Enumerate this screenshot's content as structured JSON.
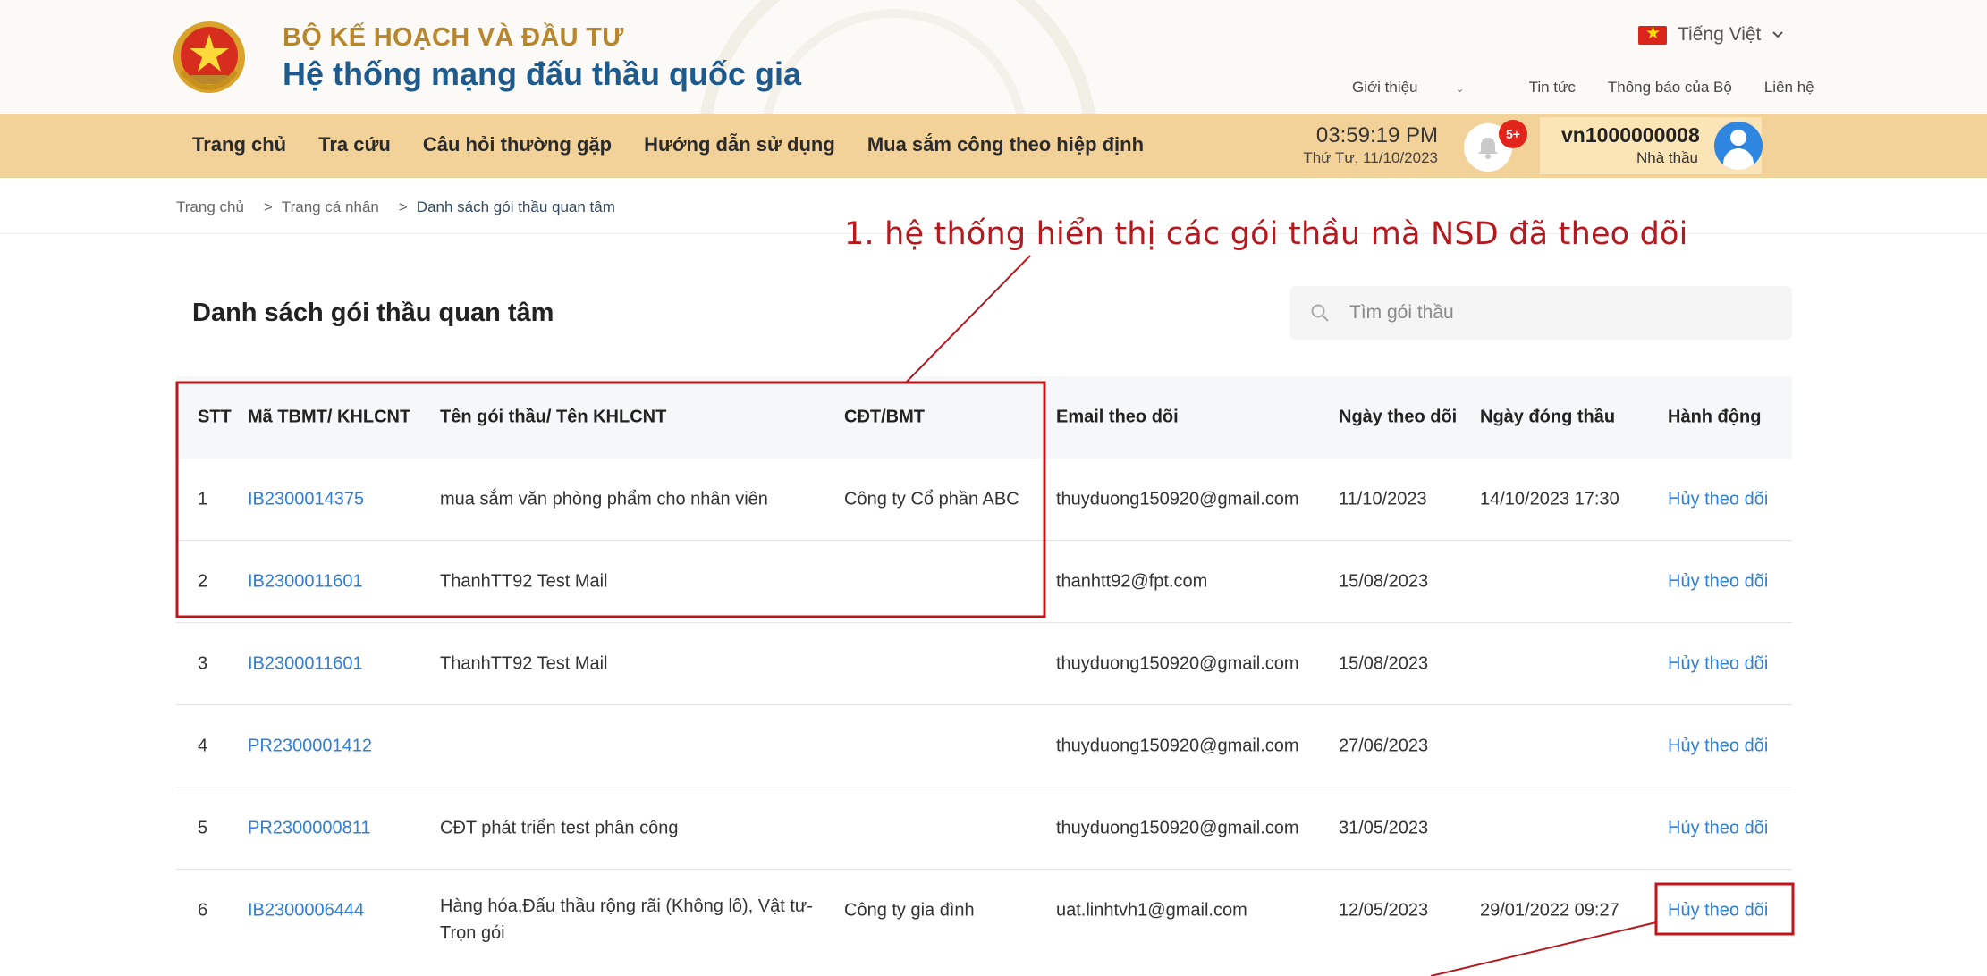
{
  "header": {
    "org_name": "BỘ KẾ HOẠCH VÀ ĐẦU TƯ",
    "system_name": "Hệ thống mạng đấu thầu quốc gia",
    "language": "Tiếng Việt",
    "top_links": [
      "Giới thiệu",
      "Tin tức",
      "Thông báo của Bộ",
      "Liên hệ"
    ]
  },
  "nav": {
    "items": [
      "Trang chủ",
      "Tra cứu",
      "Câu hỏi thường gặp",
      "Hướng dẫn sử dụng",
      "Mua sắm công theo hiệp định"
    ],
    "time": "03:59:19 PM",
    "date": "Thứ Tư, 11/10/2023",
    "notification_badge": "5+",
    "user_name": "vn1000000008",
    "user_role": "Nhà thầu"
  },
  "breadcrumb": [
    "Trang chủ",
    "Trang cá nhân",
    "Danh sách gói thầu quan tâm"
  ],
  "annotation": "1. hệ thống hiển thị các gói thầu mà NSD đã theo dõi",
  "page_title": "Danh sách gói thầu quan tâm",
  "search": {
    "placeholder": "Tìm gói thầu"
  },
  "table": {
    "headers": [
      "STT",
      "Mã TBMT/ KHLCNT",
      "Tên gói thầu/ Tên KHLCNT",
      "CĐT/BMT",
      "Email theo dõi",
      "Ngày theo dõi",
      "Ngày đóng thầu",
      "Hành động"
    ],
    "rows": [
      {
        "stt": "1",
        "code": "IB2300014375",
        "name": "mua sắm văn phòng phẩm cho nhân viên",
        "owner": "Công ty Cổ phần ABC",
        "email": "thuyduong150920@gmail.com",
        "follow_date": "11/10/2023",
        "close_date": "14/10/2023 17:30",
        "action": "Hủy theo dõi"
      },
      {
        "stt": "2",
        "code": "IB2300011601",
        "name": "ThanhTT92 Test Mail",
        "owner": "",
        "email": "thanhtt92@fpt.com",
        "follow_date": "15/08/2023",
        "close_date": "",
        "action": "Hủy theo dõi"
      },
      {
        "stt": "3",
        "code": "IB2300011601",
        "name": "ThanhTT92 Test Mail",
        "owner": "",
        "email": "thuyduong150920@gmail.com",
        "follow_date": "15/08/2023",
        "close_date": "",
        "action": "Hủy theo dõi"
      },
      {
        "stt": "4",
        "code": "PR2300001412",
        "name": "",
        "owner": "",
        "email": "thuyduong150920@gmail.com",
        "follow_date": "27/06/2023",
        "close_date": "",
        "action": "Hủy theo dõi"
      },
      {
        "stt": "5",
        "code": "PR2300000811",
        "name": "CĐT phát triển test phân công",
        "owner": "",
        "email": "thuyduong150920@gmail.com",
        "follow_date": "31/05/2023",
        "close_date": "",
        "action": "Hủy theo dõi"
      },
      {
        "stt": "6",
        "code": "IB2300006444",
        "name": "Hàng hóa,Đấu thầu rộng rãi (Không lô), Vật tư-Trọn gói",
        "owner": "Công ty gia đình",
        "email": "uat.linhtvh1@gmail.com",
        "follow_date": "12/05/2023",
        "close_date": "29/01/2022 09:27",
        "action": "Hủy theo dõi"
      }
    ]
  },
  "colors": {
    "navbar": "#f3d29a",
    "link": "#2f7ed8",
    "annotation": "#b3191f",
    "org_name": "#b8862c",
    "system_name": "#1f5a8c"
  }
}
